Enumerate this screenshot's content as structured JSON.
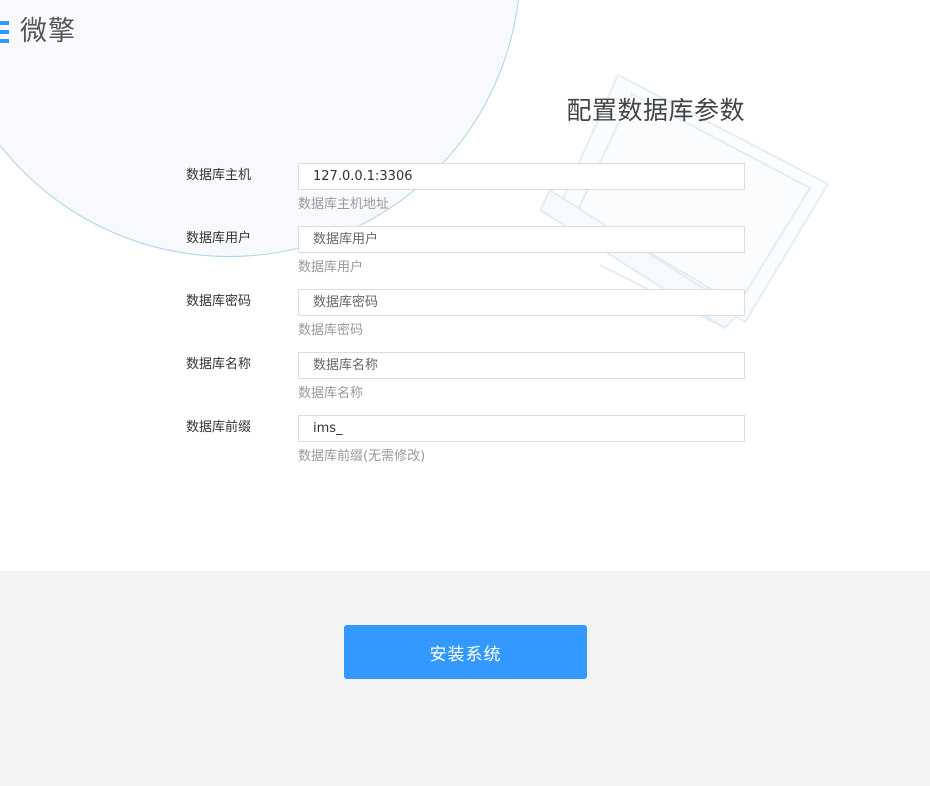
{
  "brand": {
    "name": "微擎",
    "icon": "logo-icon",
    "accent": "#3399ff"
  },
  "page": {
    "title": "配置数据库参数"
  },
  "form": {
    "fields": [
      {
        "label": "数据库主机",
        "value": "127.0.0.1:3306",
        "placeholder": "",
        "hint": "数据库主机地址"
      },
      {
        "label": "数据库用户",
        "value": "",
        "placeholder": "数据库用户",
        "hint": "数据库用户"
      },
      {
        "label": "数据库密码",
        "value": "",
        "placeholder": "数据库密码",
        "hint": "数据库密码"
      },
      {
        "label": "数据库名称",
        "value": "",
        "placeholder": "数据库名称",
        "hint": "数据库名称"
      },
      {
        "label": "数据库前缀",
        "value": "ims_",
        "placeholder": "",
        "hint": "数据库前缀(无需修改)"
      }
    ]
  },
  "actions": {
    "install_label": "安装系统",
    "install_color": "#3399ff"
  },
  "colors": {
    "footer_background": "#f3f3f3",
    "circle_border": "#a9d3ee"
  }
}
